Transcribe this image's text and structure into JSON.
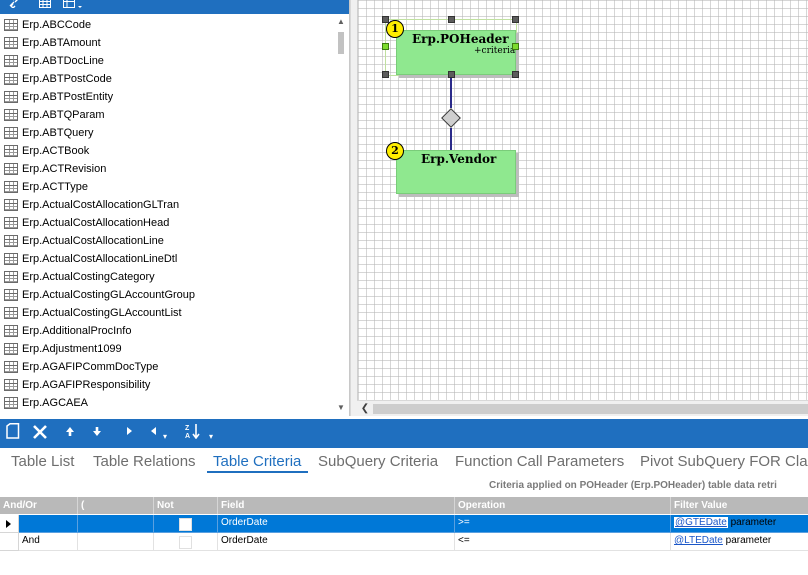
{
  "left_toolbar": {
    "icons": [
      "link-icon",
      "table-icon",
      "table-dropdown-icon"
    ]
  },
  "table_list": {
    "items": [
      "Erp.ABCCode",
      "Erp.ABTAmount",
      "Erp.ABTDocLine",
      "Erp.ABTPostCode",
      "Erp.ABTPostEntity",
      "Erp.ABTQParam",
      "Erp.ABTQuery",
      "Erp.ACTBook",
      "Erp.ACTRevision",
      "Erp.ACTType",
      "Erp.ActualCostAllocationGLTran",
      "Erp.ActualCostAllocationHead",
      "Erp.ActualCostAllocationLine",
      "Erp.ActualCostAllocationLineDtl",
      "Erp.ActualCostingCategory",
      "Erp.ActualCostingGLAccountGroup",
      "Erp.ActualCostingGLAccountList",
      "Erp.AdditionalProcInfo",
      "Erp.Adjustment1099",
      "Erp.AGAFIPCommDocType",
      "Erp.AGAFIPResponsibility",
      "Erp.AGCAEA"
    ]
  },
  "diagram": {
    "entities": [
      {
        "number": "1",
        "name": "Erp.POHeader",
        "sub": "+criteria"
      },
      {
        "number": "2",
        "name": "Erp.Vendor",
        "sub": ""
      }
    ]
  },
  "bottom_toolbar": {
    "icons": [
      "new-icon",
      "delete-icon",
      "move-up-icon",
      "move-down-icon",
      "indent-icon",
      "outdent-icon",
      "sort-icon"
    ]
  },
  "tabs": [
    {
      "label": "Table List",
      "active": false
    },
    {
      "label": "Table Relations",
      "active": false
    },
    {
      "label": "Table Criteria",
      "active": true
    },
    {
      "label": "SubQuery Criteria",
      "active": false
    },
    {
      "label": "Function Call Parameters",
      "active": false
    },
    {
      "label": "Pivot SubQuery FOR Clau",
      "active": false
    }
  ],
  "criteria_note": "Criteria applied on POHeader (Erp.POHeader)  table data retri",
  "grid": {
    "headers": [
      "And/Or",
      "(",
      "Not",
      "Field",
      "Operation",
      "Filter Value"
    ],
    "rows": [
      {
        "and_or": "",
        "paren": "",
        "field": "OrderDate",
        "operation": ">=",
        "filter_link": "@GTEDate",
        "filter_suffix": " parameter",
        "selected": true
      },
      {
        "and_or": "And",
        "paren": "",
        "field": "OrderDate",
        "operation": "<=",
        "filter_link": "@LTEDate",
        "filter_suffix": " parameter",
        "selected": false
      }
    ]
  },
  "colors": {
    "toolbar_blue": "#1f6fbf",
    "entity_green": "#8fe88f",
    "badge_yellow": "#ffee00",
    "selection_blue": "#0078d7",
    "grid_header_gray": "#b9b9b9"
  }
}
